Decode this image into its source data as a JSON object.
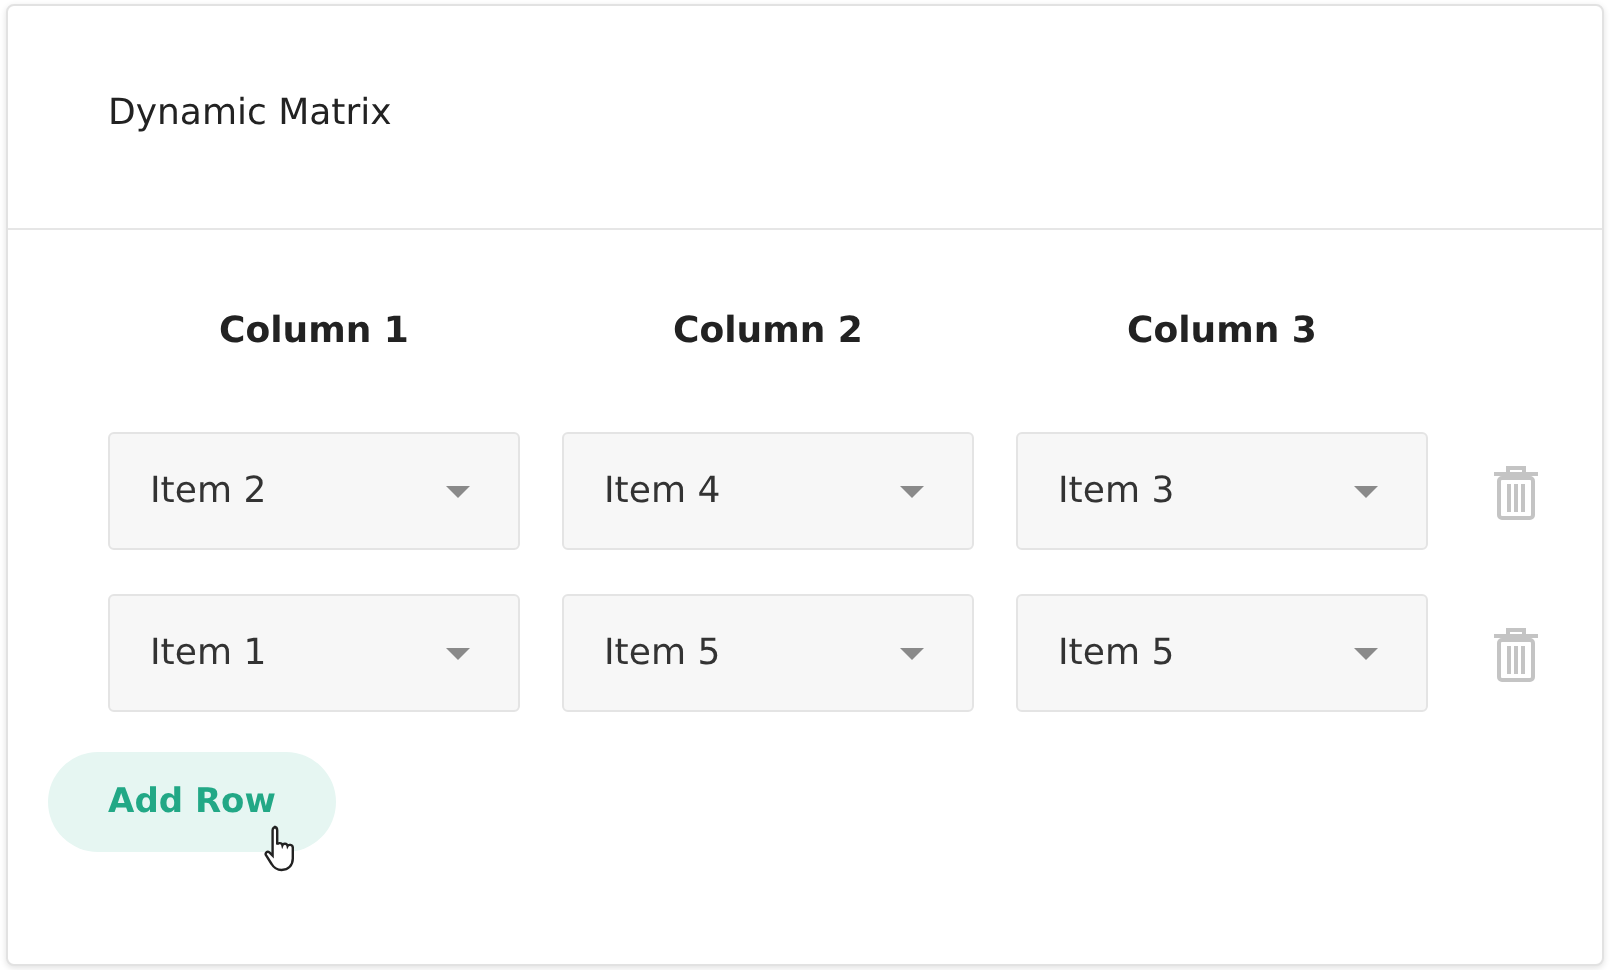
{
  "title": "Dynamic Matrix",
  "columns": [
    "Column 1",
    "Column 2",
    "Column 3"
  ],
  "rows": [
    {
      "cells": [
        "Item 2",
        "Item 4",
        "Item 3"
      ]
    },
    {
      "cells": [
        "Item 1",
        "Item 5",
        "Item 5"
      ]
    }
  ],
  "add_button": "Add Row"
}
